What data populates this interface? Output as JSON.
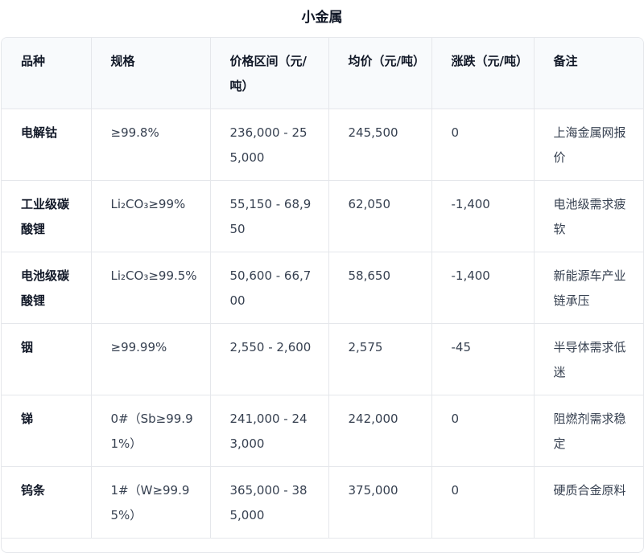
{
  "title": "小金属",
  "table": {
    "headers": [
      "品种",
      "规格",
      "价格区间（元/吨）",
      "均价（元/吨）",
      "涨跌（元/吨）",
      "备注"
    ],
    "rows": [
      [
        "电解钴",
        "≥99.8%",
        "236,000 - 255,000",
        "245,500",
        "0",
        "上海金属网报价"
      ],
      [
        "工业级碳酸锂",
        "Li₂CO₃≥99%",
        "55,150 - 68,950",
        "62,050",
        "-1,400",
        "电池级需求疲软"
      ],
      [
        "电池级碳酸锂",
        "Li₂CO₃≥99.5%",
        "50,600 - 66,700",
        "58,650",
        "-1,400",
        "新能源车产业链承压"
      ],
      [
        "铟",
        "≥99.99%",
        "2,550 - 2,600",
        "2,575",
        "-45",
        "半导体需求低迷"
      ],
      [
        "锑",
        "0#（Sb≥99.91%）",
        "241,000 - 243,000",
        "242,000",
        "0",
        "阻燃剂需求稳定"
      ],
      [
        "钨条",
        "1#（W≥99.95%）",
        "365,000 - 385,000",
        "375,000",
        "0",
        "硬质合金原料"
      ]
    ]
  }
}
